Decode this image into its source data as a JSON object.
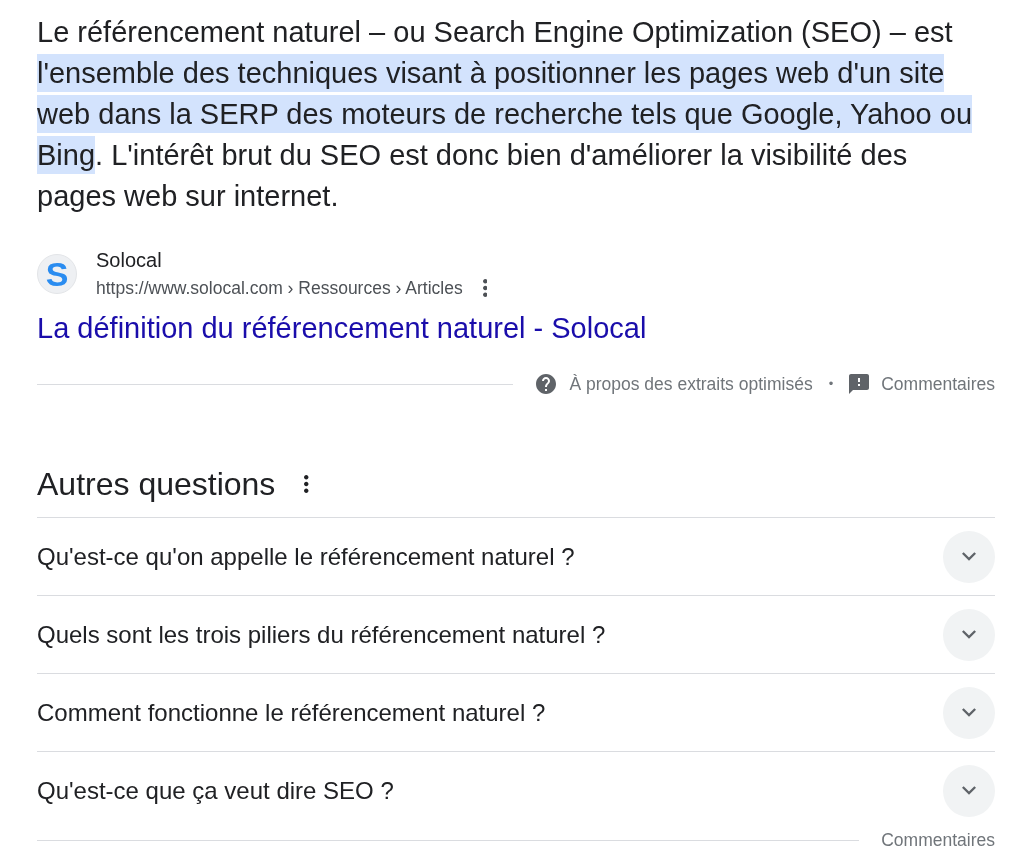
{
  "snippet": {
    "segments": [
      {
        "text": "Le référencement naturel – ou Search Engine Optimization (SEO) – est ",
        "highlighted": false
      },
      {
        "text": "l'ensemble des techniques visant à positionner les pages web d'un site web dans la SERP des moteurs de recherche tels que Google, Yahoo ou Bing",
        "highlighted": true
      },
      {
        "text": ". L'intérêt brut du SEO est donc bien d'améliorer la visibilité des pages web sur internet.",
        "highlighted": false
      }
    ]
  },
  "source": {
    "logo_text": "S",
    "site_name": "Solocal",
    "url": "https://www.solocal.com › Ressources › Articles",
    "title": "La définition du référencement naturel - Solocal"
  },
  "snippet_footer": {
    "about": "À propos des extraits optimisés",
    "separator": "•",
    "feedback": "Commentaires"
  },
  "related_questions": {
    "heading": "Autres questions",
    "items": [
      {
        "question": "Qu'est-ce qu'on appelle le référencement naturel ?",
        "expanded": false
      },
      {
        "question": "Quels sont les trois piliers du référencement naturel ?",
        "expanded": false
      },
      {
        "question": "Comment fonctionne le référencement naturel ?",
        "expanded": false
      },
      {
        "question": "Qu'est-ce que ça veut dire SEO ?",
        "expanded": false
      }
    ],
    "feedback": "Commentaires"
  }
}
